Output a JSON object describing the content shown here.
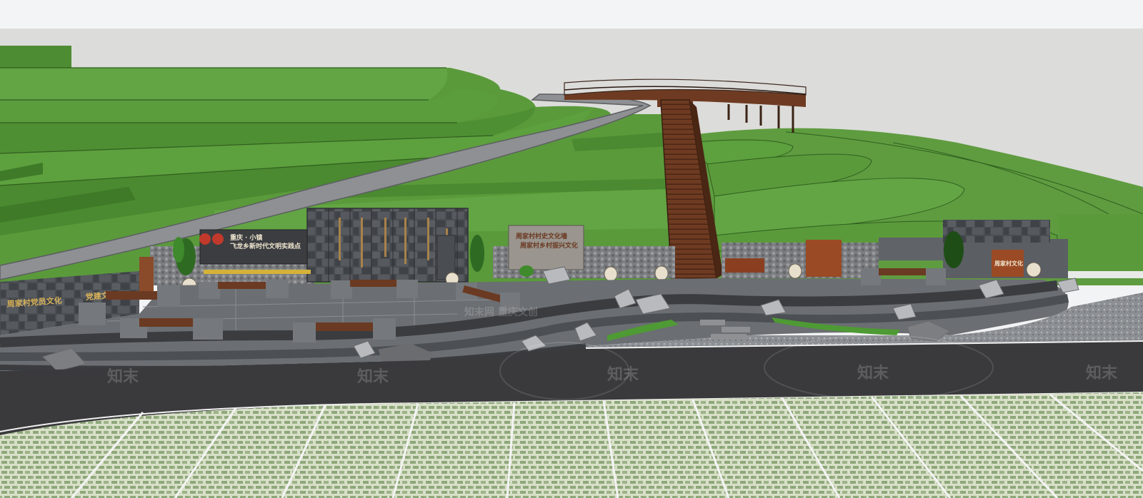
{
  "scene": {
    "sign_left_wall": "周家村党员文化",
    "sign_left_wall_2": "党建文化",
    "sign_board_line1": "重庆 · 小镇",
    "sign_board_line2": "飞龙乡新时代文明实践点",
    "sign_panel": "周家村村史文化墙",
    "sign_panel_2": "周家村乡村振兴文化",
    "sign_right": "周家村文化"
  },
  "watermark": {
    "brand": "知末",
    "mid_text": "知末网 重庆文创"
  },
  "colors": {
    "sky": "#f2f3f4",
    "terrace": "#5c9a3e",
    "terrace_dark": "#3f7a2a",
    "road": "#3a3a3c",
    "plaza": "#6e7175",
    "wood": "#6b3a22",
    "grass_paver": "#c8d4b4"
  }
}
